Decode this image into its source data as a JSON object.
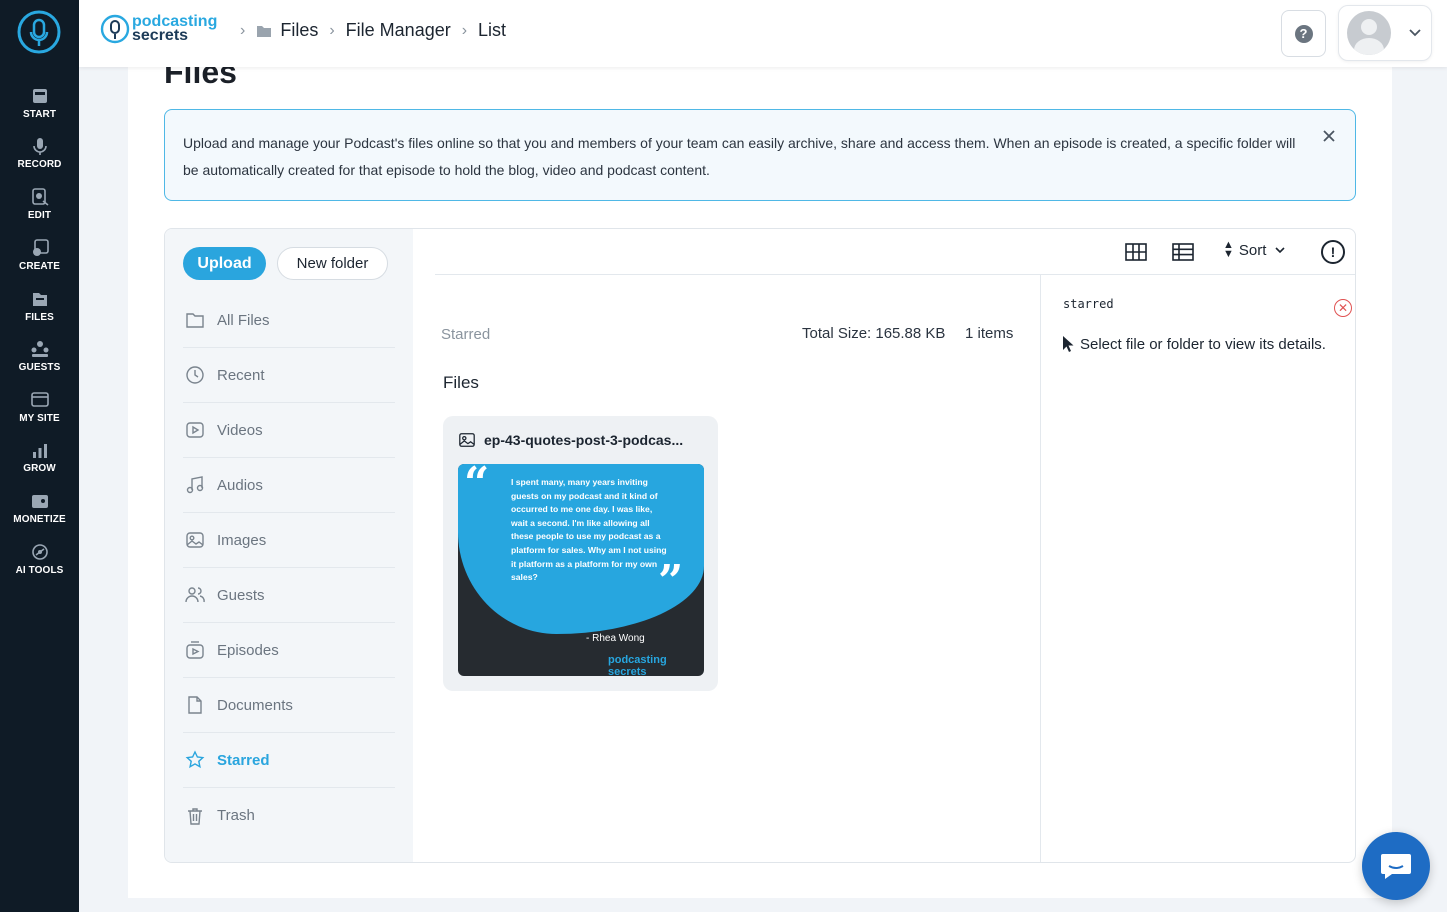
{
  "nav": {
    "items": [
      {
        "label": "START",
        "icon": "start-icon"
      },
      {
        "label": "RECORD",
        "icon": "microphone-icon"
      },
      {
        "label": "EDIT",
        "icon": "edit-icon"
      },
      {
        "label": "CREATE",
        "icon": "create-icon"
      },
      {
        "label": "FILES",
        "icon": "files-icon"
      },
      {
        "label": "GUESTS",
        "icon": "guests-icon"
      },
      {
        "label": "MY SITE",
        "icon": "site-icon"
      },
      {
        "label": "GROW",
        "icon": "grow-icon"
      },
      {
        "label": "MONETIZE",
        "icon": "monetize-icon"
      },
      {
        "label": "AI TOOLS",
        "icon": "ai-tools-icon"
      }
    ]
  },
  "header": {
    "logo_line1": "podcasting",
    "logo_line2": "secrets",
    "breadcrumb": [
      "Files",
      "File Manager",
      "List"
    ],
    "help_label": "?"
  },
  "page": {
    "title": "Files",
    "info_text": "Upload and manage your Podcast's files online so that you and members of your team can easily archive, share and access them. When an episode is created, a specific folder will be automatically created for that episode to hold the blog, video and podcast content."
  },
  "sidebar": {
    "upload_label": "Upload",
    "new_folder_label": "New folder",
    "items": [
      {
        "label": "All Files",
        "icon": "folder-icon"
      },
      {
        "label": "Recent",
        "icon": "clock-icon"
      },
      {
        "label": "Videos",
        "icon": "video-icon"
      },
      {
        "label": "Audios",
        "icon": "music-icon"
      },
      {
        "label": "Images",
        "icon": "image-icon"
      },
      {
        "label": "Guests",
        "icon": "users-icon"
      },
      {
        "label": "Episodes",
        "icon": "episodes-icon"
      },
      {
        "label": "Documents",
        "icon": "document-icon"
      },
      {
        "label": "Starred",
        "icon": "star-icon",
        "active": true
      },
      {
        "label": "Trash",
        "icon": "trash-icon"
      }
    ]
  },
  "toolbar": {
    "sort_label": "Sort",
    "info_label": "!"
  },
  "content": {
    "section_label": "Starred",
    "total_size": "Total Size: 165.88 KB",
    "items_count": "1 items",
    "files_heading": "Files",
    "file": {
      "name": "ep-43-quotes-post-3-podcas...",
      "quote": "I spent many, many years inviting guests on my podcast and it kind of occurred to me one day. I was like, wait a second. I'm like allowing all these people to use my podcast as a platform for sales. Why am I not using it platform as a platform for my own sales?",
      "author": "- Rhea Wong",
      "thumb_logo": "podcasting secrets"
    }
  },
  "details": {
    "title": "starred",
    "hint": "Select file or folder to view its details."
  },
  "colors": {
    "accent": "#2aa5de",
    "nav_bg": "#0f1b26",
    "chat": "#1e6cc4"
  }
}
